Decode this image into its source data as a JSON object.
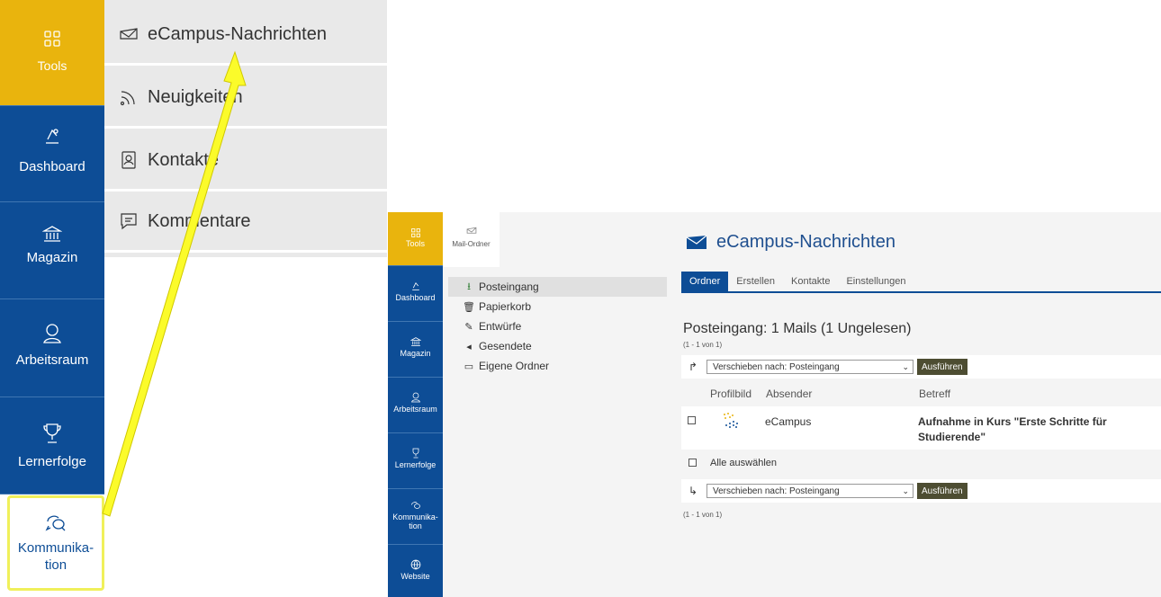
{
  "big_sidebar": {
    "items": [
      {
        "label": "Tools"
      },
      {
        "label": "Dashboard"
      },
      {
        "label": "Magazin"
      },
      {
        "label": "Arbeitsraum"
      },
      {
        "label": "Lernerfolge"
      },
      {
        "label": "Kommunika-\ntion"
      }
    ]
  },
  "flyout": {
    "items": [
      {
        "label": "eCampus-Nachrichten"
      },
      {
        "label": "Neuigkeiten"
      },
      {
        "label": "Kontakte"
      },
      {
        "label": "Kommentare"
      }
    ]
  },
  "mini_sidebar": {
    "items": [
      {
        "label": "Tools"
      },
      {
        "label": "Dashboard"
      },
      {
        "label": "Magazin"
      },
      {
        "label": "Arbeitsraum"
      },
      {
        "label": "Lernerfolge"
      },
      {
        "label": "Kommunika-\ntion"
      },
      {
        "label": "Website"
      }
    ]
  },
  "mail_tab": {
    "label": "Mail-Ordner"
  },
  "folders": [
    {
      "label": "Posteingang",
      "icon": "inbox-icon"
    },
    {
      "label": "Papierkorb",
      "icon": "trash-icon"
    },
    {
      "label": "Entwürfe",
      "icon": "pencil-icon"
    },
    {
      "label": "Gesendete",
      "icon": "send-icon"
    },
    {
      "label": "Eigene Ordner",
      "icon": "folder-icon"
    }
  ],
  "main": {
    "title": "eCampus-Nachrichten",
    "tabs": [
      "Ordner",
      "Erstellen",
      "Kontakte",
      "Einstellungen"
    ],
    "inbox_title": "Posteingang: 1 Mails (1 Ungelesen)",
    "range": "(1 - 1 von 1)",
    "move_select": "Verschieben nach: Posteingang",
    "run_button": "Ausführen",
    "columns": [
      "Profilbild",
      "Absender",
      "Betreff"
    ],
    "messages": [
      {
        "sender": "eCampus",
        "subject": "Aufnahme in Kurs \"Erste Schritte für Studierende\""
      }
    ],
    "select_all": "Alle auswählen"
  },
  "colors": {
    "brand_blue": "#0d4d96",
    "tools_yellow": "#e9b40d",
    "highlight_yellow": "#f0f05a"
  }
}
